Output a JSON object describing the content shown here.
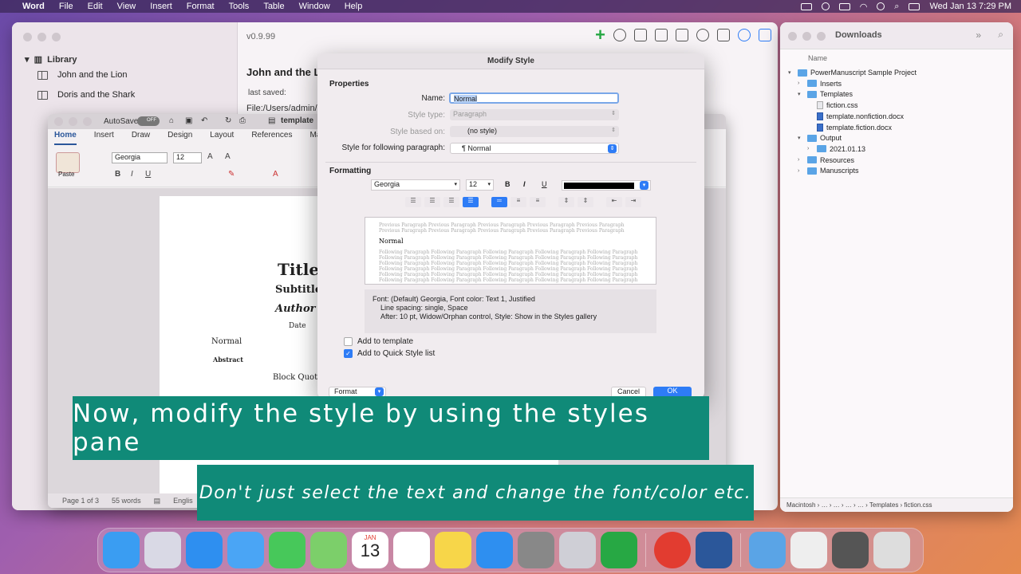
{
  "menubar": {
    "apple": "",
    "app": "Word",
    "items": [
      "File",
      "Edit",
      "View",
      "Insert",
      "Format",
      "Tools",
      "Table",
      "Window",
      "Help"
    ],
    "clock": "Wed Jan 13  7:29 PM"
  },
  "powermanuscript": {
    "version": "v0.9.99",
    "library_heading": "Library",
    "library_items": [
      "John and the Lion",
      "Doris and the Shark"
    ],
    "project_title": "John and the L",
    "last_saved_label": "last saved:",
    "path": "File:/Users/admin/D"
  },
  "finder": {
    "title": "Downloads",
    "column": "Name",
    "rows": [
      {
        "name": "PowerManuscript Sample Project",
        "type": "folder",
        "indent": 0,
        "open": true
      },
      {
        "name": "Inserts",
        "type": "folder",
        "indent": 1,
        "open": false
      },
      {
        "name": "Templates",
        "type": "folder",
        "indent": 1,
        "open": true
      },
      {
        "name": "fiction.css",
        "type": "file",
        "indent": 2
      },
      {
        "name": "template.nonfiction.docx",
        "type": "docx",
        "indent": 2
      },
      {
        "name": "template.fiction.docx",
        "type": "docx",
        "indent": 2
      },
      {
        "name": "Output",
        "type": "folder",
        "indent": 1,
        "open": true
      },
      {
        "name": "2021.01.13",
        "type": "folder",
        "indent": 2,
        "open": false
      },
      {
        "name": "Resources",
        "type": "folder",
        "indent": 1,
        "open": false
      },
      {
        "name": "Manuscripts",
        "type": "folder",
        "indent": 1,
        "open": false
      }
    ],
    "pathbar": "Macintosh  ›  …  ›  …  ›  …  ›  …  ›  Templates  ›  fiction.css"
  },
  "word": {
    "autosave": "AutoSave",
    "autosave_state": "OFF",
    "docname": "template",
    "tabs": [
      "Home",
      "Insert",
      "Draw",
      "Design",
      "Layout",
      "References",
      "Mail"
    ],
    "font": "Georgia",
    "size": "12",
    "paste_label": "Paste",
    "page": {
      "title": "Title",
      "subtitle": "Subtitle",
      "author": "Author",
      "date": "Date",
      "normal": "Normal",
      "abstract": "Abstract",
      "blockquote": "Block Quote"
    },
    "status": {
      "page": "Page 1 of 3",
      "words": "55 words",
      "lang": "Englis"
    }
  },
  "dialog": {
    "title": "Modify Style",
    "properties_heading": "Properties",
    "name_label": "Name:",
    "name_value": "Normal",
    "style_type_label": "Style type:",
    "style_type_value": "Paragraph",
    "based_on_label": "Style based on:",
    "based_on_value": "(no style)",
    "following_label": "Style for following paragraph:",
    "following_value": "¶ Normal",
    "formatting_heading": "Formatting",
    "font": "Georgia",
    "size": "12",
    "bold": "B",
    "italic": "I",
    "underline": "U",
    "font_color": "#000000",
    "preview_previous": "Previous Paragraph Previous Paragraph Previous Paragraph Previous Paragraph Previous Paragraph Previous Paragraph Previous Paragraph Previous Paragraph Previous Paragraph Previous Paragraph",
    "preview_normal": "Normal",
    "preview_following": "Following Paragraph Following Paragraph Following Paragraph Following Paragraph Following Paragraph Following Paragraph Following Paragraph Following Paragraph Following Paragraph Following Paragraph Following Paragraph Following Paragraph Following Paragraph Following Paragraph Following Paragraph Following Paragraph Following Paragraph Following Paragraph Following Paragraph Following Paragraph Following Paragraph Following Paragraph Following Paragraph Following Paragraph Following Paragraph Following Paragraph Following Paragraph Following Paragraph Following Paragraph Following Paragraph",
    "desc_line1": "Font: (Default) Georgia, Font color: Text 1, Justified",
    "desc_line2": "Line spacing:  single, Space",
    "desc_line3": "After:  10 pt, Widow/Orphan control, Style: Show in the Styles gallery",
    "add_template": "Add to template",
    "add_template_checked": false,
    "add_quick": "Add to Quick Style list",
    "add_quick_checked": true,
    "format_button": "Format",
    "cancel": "Cancel",
    "ok": "OK"
  },
  "captions": {
    "main": "Now, modify the style by using the styles pane",
    "sub": "Don't just select the text and change the font/color etc."
  },
  "dock": {
    "apps": [
      {
        "name": "finder",
        "color": "#3a9df2"
      },
      {
        "name": "launchpad",
        "color": "#d9d9e5"
      },
      {
        "name": "safari",
        "color": "#2e8ff0"
      },
      {
        "name": "mail",
        "color": "#4aa5f5"
      },
      {
        "name": "messages",
        "color": "#47c85a"
      },
      {
        "name": "maps",
        "color": "#7ccf6a"
      },
      {
        "name": "calendar",
        "color": "#ffffff"
      },
      {
        "name": "reminders",
        "color": "#ffffff"
      },
      {
        "name": "notes",
        "color": "#f7d649"
      },
      {
        "name": "app-store",
        "color": "#2e8ff0"
      },
      {
        "name": "system-preferences",
        "color": "#888888"
      },
      {
        "name": "photo-slideshow",
        "color": "#cfcfd6"
      },
      {
        "name": "vim",
        "color": "#27a844"
      },
      {
        "name": "power-manuscript",
        "color": "#e23c30"
      },
      {
        "name": "word",
        "color": "#2b579a"
      },
      {
        "name": "downloads-folder",
        "color": "#5aa4e6"
      },
      {
        "name": "stack-1",
        "color": "#eeeeee"
      },
      {
        "name": "stack-2",
        "color": "#555555"
      },
      {
        "name": "trash",
        "color": "#dddddd"
      }
    ],
    "calendar_month": "JAN",
    "calendar_day": "13"
  }
}
